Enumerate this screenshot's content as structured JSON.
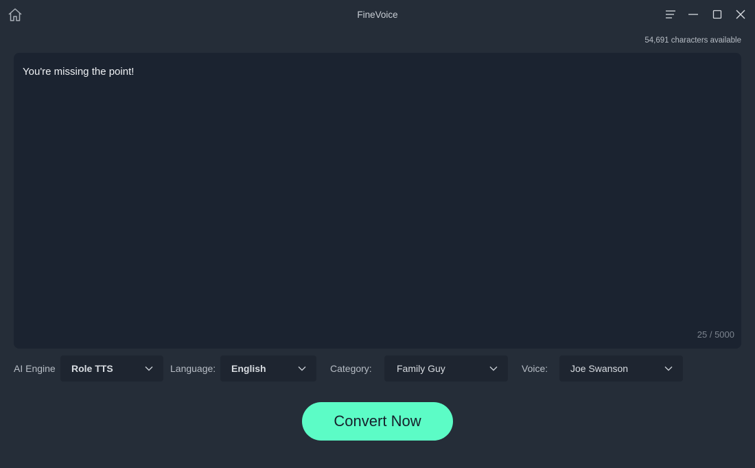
{
  "window": {
    "title": "FineVoice",
    "icons": {
      "home": "home-icon",
      "menu": "menu-icon",
      "minimize": "minimize-icon",
      "maximize": "maximize-icon",
      "close": "close-icon"
    }
  },
  "editor": {
    "chars_available": "54,691 characters available",
    "text": "You're missing the point!",
    "char_count": "25 / 5000"
  },
  "controls": {
    "ai_engine": {
      "label": "AI Engine",
      "value": "Role TTS"
    },
    "language": {
      "label": "Language:",
      "value": "English"
    },
    "category": {
      "label": "Category:",
      "value": "Family Guy"
    },
    "voice": {
      "label": "Voice:",
      "value": "Joe Swanson"
    }
  },
  "actions": {
    "convert_label": "Convert Now"
  },
  "colors": {
    "accent": "#5cfcc6",
    "background": "#252d38",
    "editor_bg": "#1b2330"
  }
}
